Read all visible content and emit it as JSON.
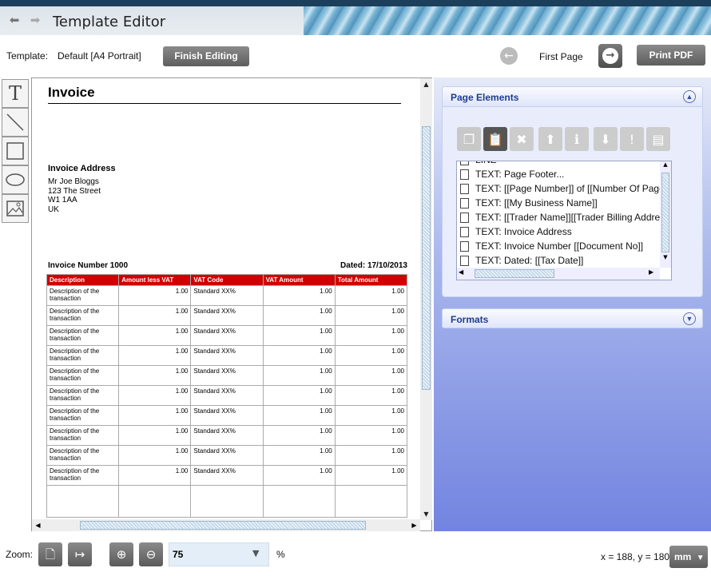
{
  "header": {
    "title": "Template Editor",
    "back_icon": "arrow-left-icon",
    "forward_icon": "arrow-right-icon"
  },
  "toolbar": {
    "template_label": "Template:",
    "template_value": "Default [A4 Portrait]",
    "finish_label": "Finish Editing",
    "page_label": "First Page",
    "print_label": "Print PDF"
  },
  "tools": [
    "text-tool-icon",
    "line-tool-icon",
    "rectangle-tool-icon",
    "ellipse-tool-icon",
    "image-tool-icon"
  ],
  "invoice": {
    "title": "Invoice",
    "address_heading": "Invoice Address",
    "address_lines": [
      "Mr Joe Bloggs",
      "123 The Street",
      "W1 1AA",
      "UK"
    ],
    "number": "Invoice Number 1000",
    "dated": "Dated: 17/10/2013",
    "columns": [
      "Description",
      "Amount less VAT",
      "VAT Code",
      "VAT Amount",
      "Total Amount"
    ],
    "rows": [
      [
        "Description of the transaction",
        "1.00",
        "Standard XX%",
        "1.00",
        "1.00"
      ],
      [
        "Description of the transaction",
        "1.00",
        "Standard XX%",
        "1.00",
        "1.00"
      ],
      [
        "Description of the transaction",
        "1.00",
        "Standard XX%",
        "1.00",
        "1.00"
      ],
      [
        "Description of the transaction",
        "1.00",
        "Standard XX%",
        "1.00",
        "1.00"
      ],
      [
        "Description of the transaction",
        "1.00",
        "Standard XX%",
        "1.00",
        "1.00"
      ],
      [
        "Description of the transaction",
        "1.00",
        "Standard XX%",
        "1.00",
        "1.00"
      ],
      [
        "Description of the transaction",
        "1.00",
        "Standard XX%",
        "1.00",
        "1.00"
      ],
      [
        "Description of the transaction",
        "1.00",
        "Standard XX%",
        "1.00",
        "1.00"
      ],
      [
        "Description of the transaction",
        "1.00",
        "Standard XX%",
        "1.00",
        "1.00"
      ],
      [
        "Description of the transaction",
        "1.00",
        "Standard XX%",
        "1.00",
        "1.00"
      ]
    ]
  },
  "page_elements": {
    "title": "Page Elements",
    "items": [
      "LINE",
      "TEXT: Page Footer...",
      "TEXT: [[Page Number]] of [[Number Of Pages]]",
      "TEXT: [[My Business Name]]",
      "TEXT: [[Trader Name]][[Trader Billing Address]]",
      "TEXT: Invoice Address",
      "TEXT: Invoice Number [[Document No]]",
      "TEXT: Dated: [[Tax Date]]"
    ]
  },
  "formats": {
    "title": "Formats"
  },
  "bottom": {
    "zoom_label": "Zoom:",
    "zoom_value": "75",
    "percent": "%",
    "coords": "x = 188, y = 180",
    "unit": "mm"
  }
}
